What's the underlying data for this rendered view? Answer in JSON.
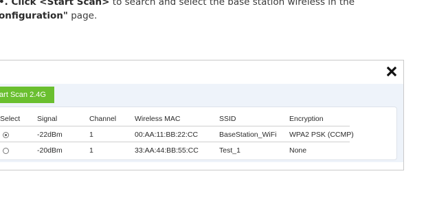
{
  "instructions": {
    "line1_prefix": "•. ",
    "line1_bold": "Click <Start Scan>",
    "line1_rest": " to search and select the base station wireless in the",
    "line2_bold": "onfiguration\"",
    "line2_rest": " page."
  },
  "dialog": {
    "close_label": "✖",
    "scan_button_label": "tart Scan 2.4G",
    "table": {
      "headers": [
        "Select",
        "Signal",
        "Channel",
        "Wireless MAC",
        "SSID",
        "Encryption"
      ],
      "rows": [
        {
          "selected": true,
          "signal": "-22dBm",
          "channel": "1",
          "mac": "00:AA:11:BB:22:CC",
          "ssid": "BaseStation_WiFi",
          "encryption": "WPA2 PSK (CCMP)"
        },
        {
          "selected": false,
          "signal": "-20dBm",
          "channel": "1",
          "mac": "33:AA:44:BB:55:CC",
          "ssid": "Test_1",
          "encryption": "None"
        }
      ]
    }
  }
}
